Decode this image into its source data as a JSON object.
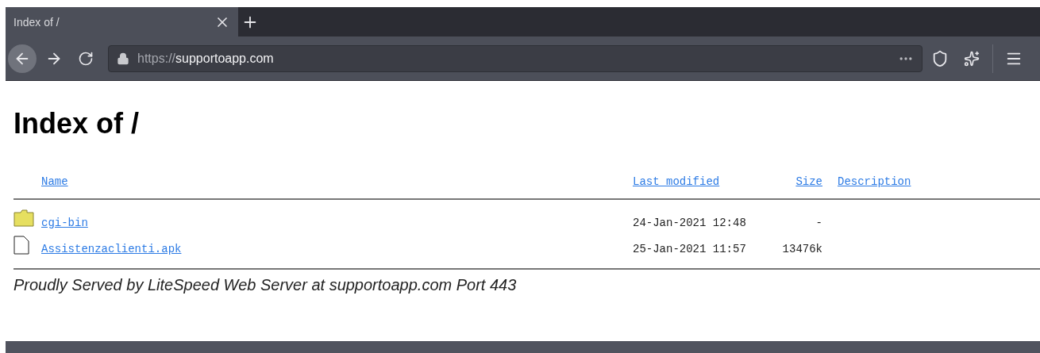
{
  "browser": {
    "tab": {
      "title": "Index of /",
      "selected": true
    },
    "url": {
      "scheme": "https://",
      "host": "supportoapp.com"
    }
  },
  "page": {
    "heading": "Index of /",
    "columns": [
      "Name",
      "Last modified",
      "Size",
      "Description"
    ],
    "rows": [
      {
        "kind": "folder",
        "name": "cgi-bin",
        "modified": "24-Jan-2021 12:48",
        "size": "-"
      },
      {
        "kind": "file",
        "name": "Assistenzaclienti.apk",
        "modified": "25-Jan-2021 11:57",
        "size": "13476k"
      }
    ],
    "footer": "Proudly Served by LiteSpeed Web Server at supportoapp.com Port 443"
  }
}
